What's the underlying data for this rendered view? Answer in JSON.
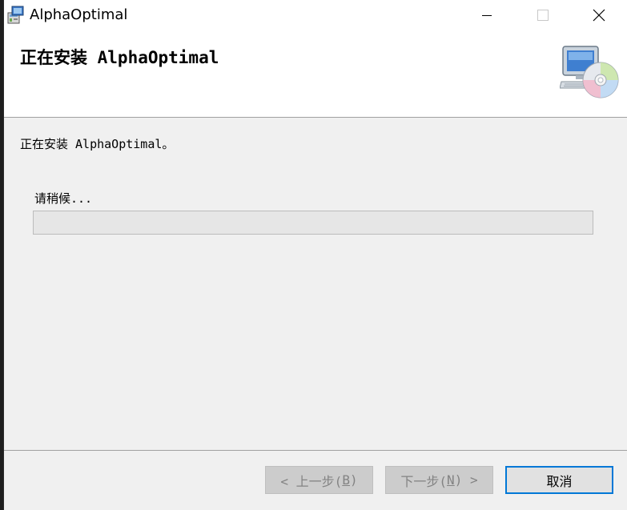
{
  "window": {
    "title": "AlphaOptimal"
  },
  "header": {
    "title": "正在安装 AlphaOptimal"
  },
  "main": {
    "status": "正在安装 AlphaOptimal。",
    "wait_label": "请稍候...",
    "progress": 0
  },
  "buttons": {
    "back": {
      "prefix": "< 上一步(",
      "key": "B",
      "suffix": ")",
      "enabled": false
    },
    "next": {
      "prefix": "下一步(",
      "key": "N",
      "suffix": ") >",
      "enabled": false
    },
    "cancel": {
      "label": "取消",
      "enabled": true
    }
  },
  "colors": {
    "focus_border": "#0078d7",
    "disabled_text": "#838383"
  }
}
